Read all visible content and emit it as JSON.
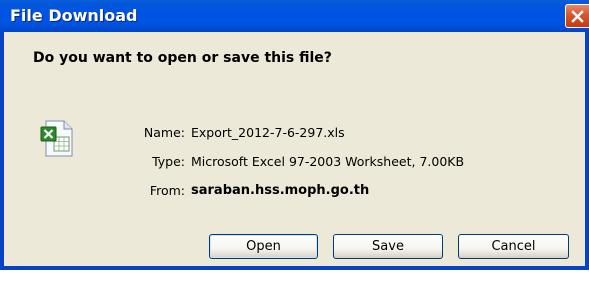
{
  "window": {
    "title": "File Download",
    "close_icon": "close-icon"
  },
  "dialog": {
    "question": "Do you want to open or save this file?",
    "file_icon": "excel-file-icon",
    "fields": {
      "name_label": "Name:",
      "name_value": "Export_2012-7-6-297.xls",
      "type_label": "Type:",
      "type_value": "Microsoft Excel 97-2003 Worksheet, 7.00KB",
      "from_label": "From:",
      "from_value": "saraban.hss.moph.go.th"
    }
  },
  "buttons": {
    "open": "Open",
    "save": "Save",
    "cancel": "Cancel"
  },
  "colors": {
    "titlebar": "#0054e3",
    "dialog_bg": "#ece9d8",
    "close_button": "#d9562a"
  }
}
